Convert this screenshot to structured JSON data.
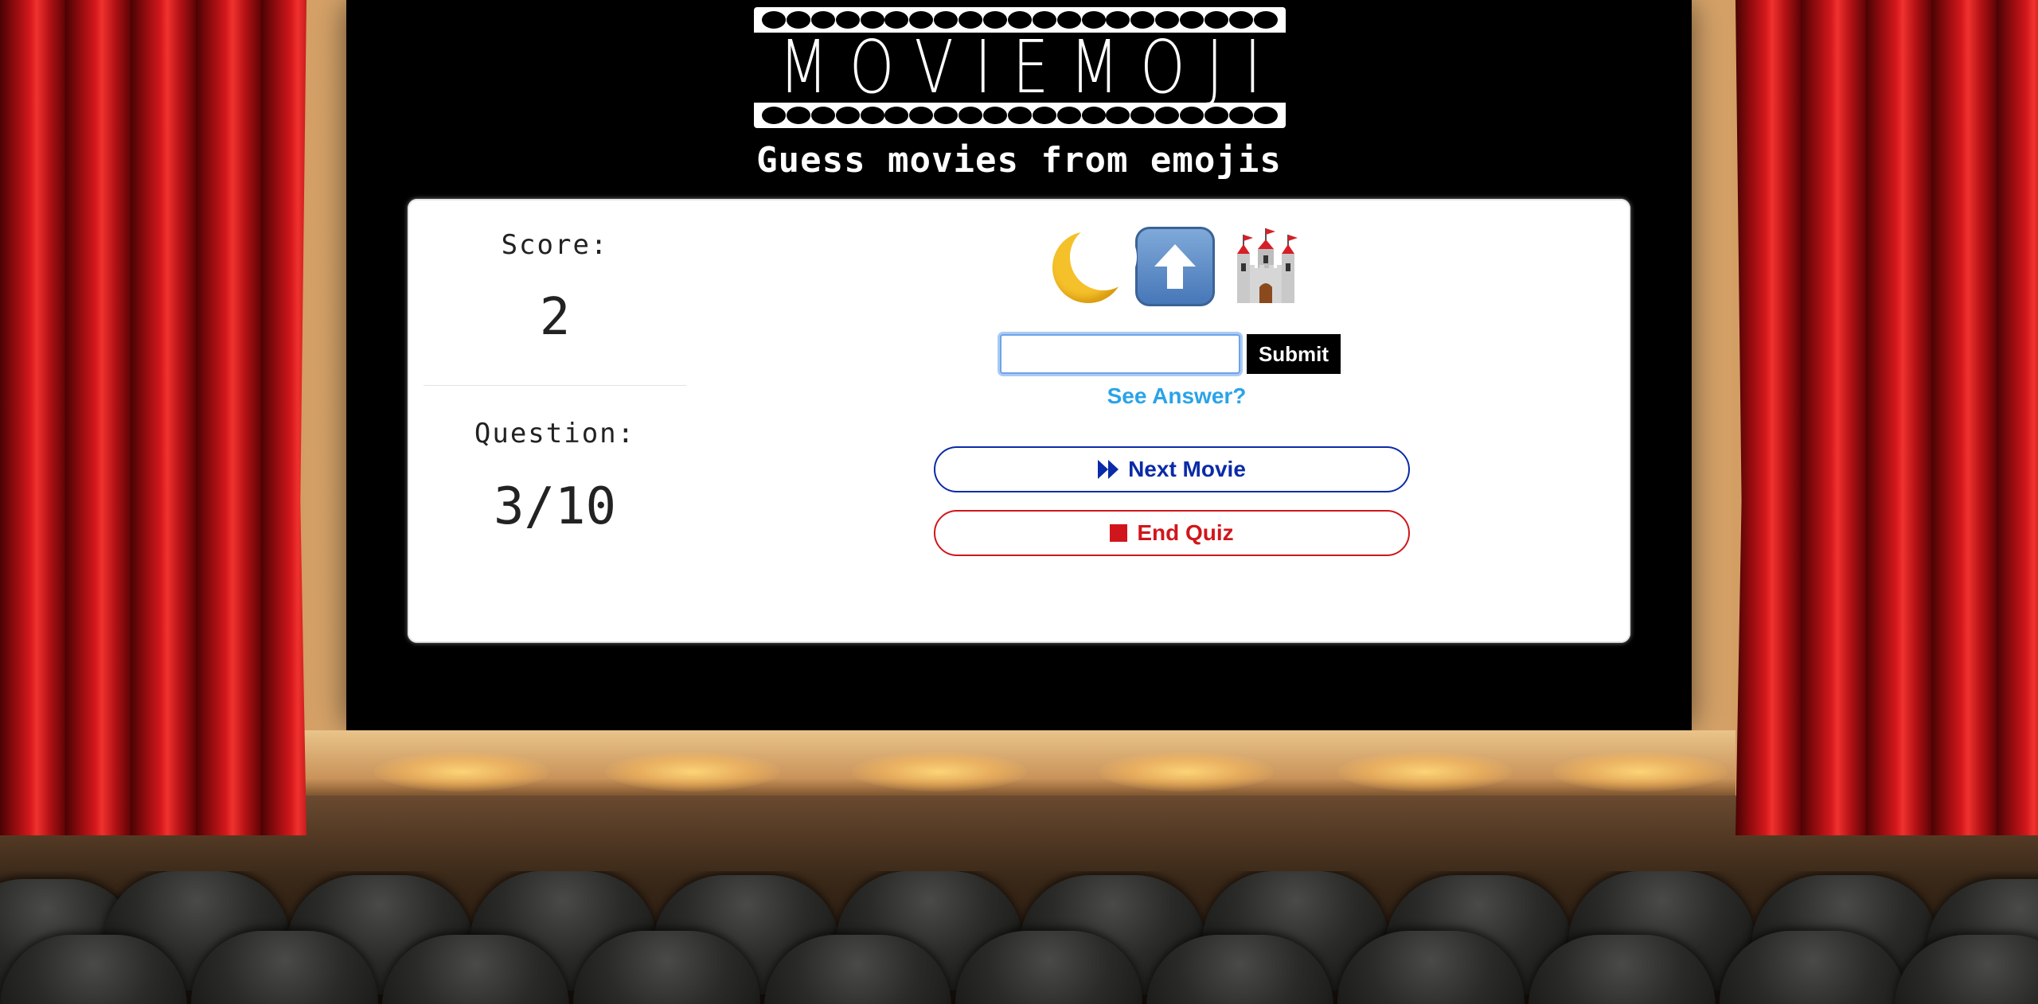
{
  "header": {
    "logo_text": "MOVIEMOJI",
    "tagline": "Guess movies from emojis"
  },
  "stats": {
    "score_label": "Score:",
    "score_value": "2",
    "question_label": "Question:",
    "question_value": "3/10"
  },
  "clue": {
    "emojis": [
      "crescent-moon",
      "up-arrow",
      "castle"
    ]
  },
  "answer": {
    "input_value": "",
    "input_placeholder": "",
    "submit_label": "Submit",
    "see_answer_label": "See Answer?"
  },
  "actions": {
    "next_label": "Next Movie",
    "end_label": "End Quiz"
  },
  "colors": {
    "next_accent": "#0a2aa8",
    "end_accent": "#d0161c",
    "link_accent": "#2aa3e8",
    "curtain_red": "#d4181c"
  }
}
